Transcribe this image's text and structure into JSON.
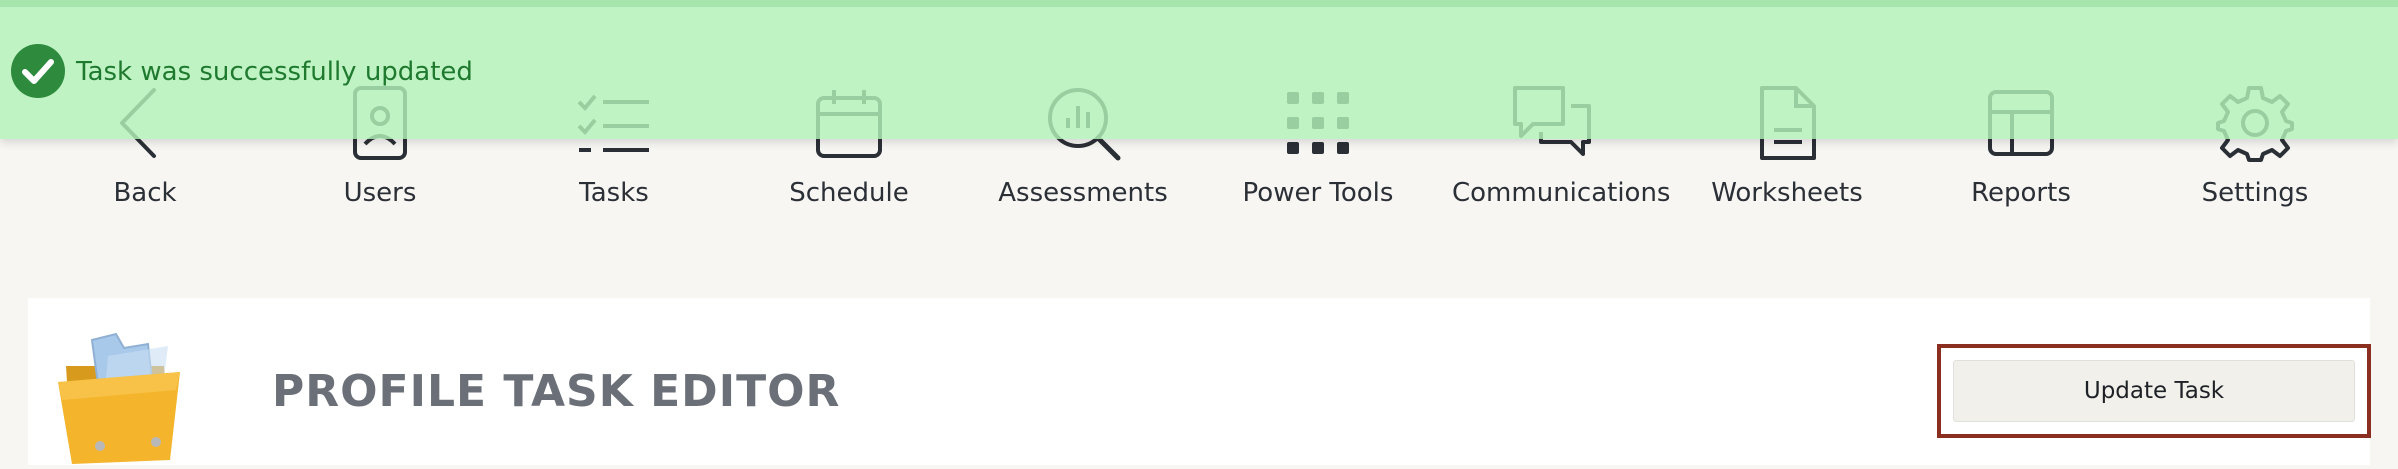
{
  "toast": {
    "message": "Task was successfully updated",
    "color": "#1f7a2f"
  },
  "nav": {
    "items": [
      {
        "label": "Back",
        "icon": "chevron-left-icon"
      },
      {
        "label": "Users",
        "icon": "user-badge-icon"
      },
      {
        "label": "Tasks",
        "icon": "checklist-icon"
      },
      {
        "label": "Schedule",
        "icon": "calendar-icon"
      },
      {
        "label": "Assessments",
        "icon": "search-chart-icon"
      },
      {
        "label": "Power Tools",
        "icon": "grid-icon"
      },
      {
        "label": "Communications",
        "icon": "chat-bubbles-icon"
      },
      {
        "label": "Worksheets",
        "icon": "document-icon"
      },
      {
        "label": "Reports",
        "icon": "report-table-icon"
      },
      {
        "label": "Settings",
        "icon": "gear-icon"
      }
    ]
  },
  "editor": {
    "title": "PROFILE TASK EDITOR",
    "update_button_label": "Update Task",
    "highlight_color": "#8a2e1f"
  }
}
